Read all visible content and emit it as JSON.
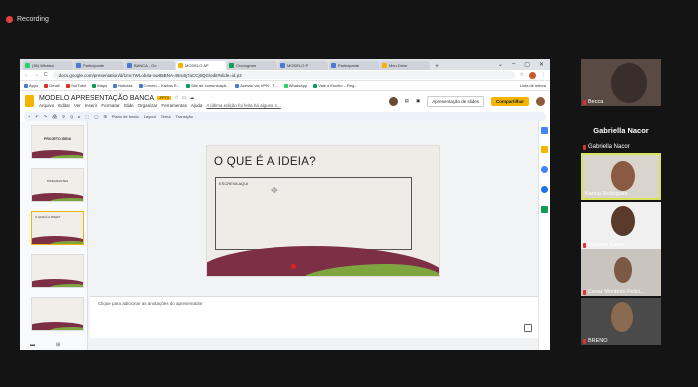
{
  "recording": {
    "label": "Recording",
    "dot_color": "#e34040"
  },
  "browser": {
    "tabs": [
      {
        "label": "(36) Whatsa",
        "color": "#25d366"
      },
      {
        "label": "Participante",
        "color": "#4a7bd0"
      },
      {
        "label": "BANCA - Go",
        "color": "#4a7bd0"
      },
      {
        "label": "MODELO AP",
        "color": "#f4b400",
        "active": true
      },
      {
        "label": "Cronogram",
        "color": "#0f9d58"
      },
      {
        "label": "MODELO P",
        "color": "#4a7bd0"
      },
      {
        "label": "Participante",
        "color": "#4a7bd0"
      },
      {
        "label": "Meu Drive",
        "color": "#f4b400"
      }
    ],
    "new_tab": "+",
    "window_controls": [
      "⌄",
      "–",
      "▢",
      "✕"
    ],
    "nav": {
      "back": "←",
      "forward": "→",
      "reload": "C"
    },
    "url": "docs.google.com/presentation/d/1mc7WLob4a-ow88BNA-45ru5j7aCCj6QG/edit#slide=id.p3",
    "bookmarks": [
      "Apps",
      "Gmail",
      "YouTube",
      "Maps",
      "Notícias",
      "Correio – Karina R...",
      "Site de comunicaçã...",
      "Acesso via VPN - T...",
      "WhatsApp",
      "Vale o Escrito – Reg..."
    ],
    "reading_list": "Lista de leitura"
  },
  "doc": {
    "title": "MODELO APRESENTAÇÃO BANCA",
    "badge": ".PPTX",
    "menus": [
      "Arquivo",
      "Editar",
      "Ver",
      "Inserir",
      "Formatar",
      "Slide",
      "Organizar",
      "Ferramentas",
      "Ajuda"
    ],
    "last_edit": "A última edição foi feita há alguns s...",
    "present_label": "Apresentação de slides",
    "share_label": "Compartilhar",
    "toolbar_items": [
      "+",
      "↶",
      "↷",
      "🖨",
      "⚲",
      "Q",
      "▸",
      "⬚",
      "◯",
      "⊞",
      "Plano de fundo",
      "Layout",
      "Tema",
      "Transição"
    ]
  },
  "filmstrip": {
    "slides": [
      {
        "num": "1",
        "text": "PROJETO IDEIA"
      },
      {
        "num": "2",
        "text": "INTEGRANTES"
      },
      {
        "num": "3",
        "text": "O QUE É A IDEIA?"
      },
      {
        "num": "4",
        "text": ""
      },
      {
        "num": "5",
        "text": ""
      }
    ]
  },
  "slide": {
    "title": "O QUE É A IDEIA?",
    "textbox": "ESCREVA AQUI"
  },
  "notes": {
    "placeholder": "Clique para adicionar as anotações do apresentador"
  },
  "participants": {
    "featured_name": "Gabriella Nacor",
    "tiles": [
      {
        "name": "Becca",
        "bg": "#5a4a44"
      },
      {
        "name": "Karina Rodrigues",
        "bg": "#d9d4cc",
        "speaking": true
      },
      {
        "name": "Mariana Xavier",
        "bg": "#f0f0f0"
      },
      {
        "name": "Cesar Monteiro Felici...",
        "bg": "#c9c4bd"
      },
      {
        "name": "BRENO",
        "bg": "#4a4a4a"
      }
    ]
  }
}
